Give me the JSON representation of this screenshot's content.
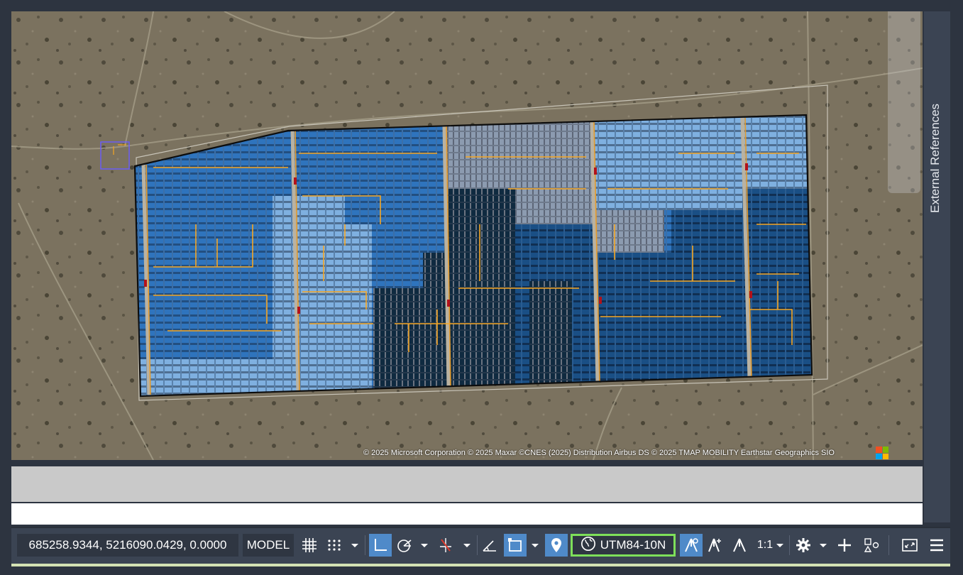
{
  "map": {
    "attribution": "© 2025 Microsoft Corporation © 2025 Maxar ©CNES (2025) Distribution Airbus DS © 2025 TMAP MOBILITY Earthstar Geographics  SIO",
    "imagery_provider_logo": "microsoft-logo"
  },
  "right_panel": {
    "label": "External References"
  },
  "status_bar": {
    "coordinates": "685258.9344, 5216090.0429, 0.0000",
    "space": "MODEL",
    "coordinate_system": "UTM84-10N",
    "annotation_scale": "1:1",
    "icons": [
      "grid-icon",
      "snap-icon",
      "ortho-icon",
      "polar-tracking-icon",
      "object-snap-tracking-icon",
      "dynamic-ucs-icon",
      "selection-cycling-icon",
      "geolocation-icon",
      "globe-icon",
      "annotation-visibility-icon",
      "auto-scale-icon",
      "annotation-scale-icon",
      "settings-icon",
      "plus-icon",
      "isolate-objects-icon",
      "fullscreen-icon",
      "customization-menu-icon"
    ]
  },
  "colors": {
    "status_bar_bg": "#3b4453",
    "active_toggle": "#4f8ac9",
    "crs_highlight": "#7ee05a"
  }
}
